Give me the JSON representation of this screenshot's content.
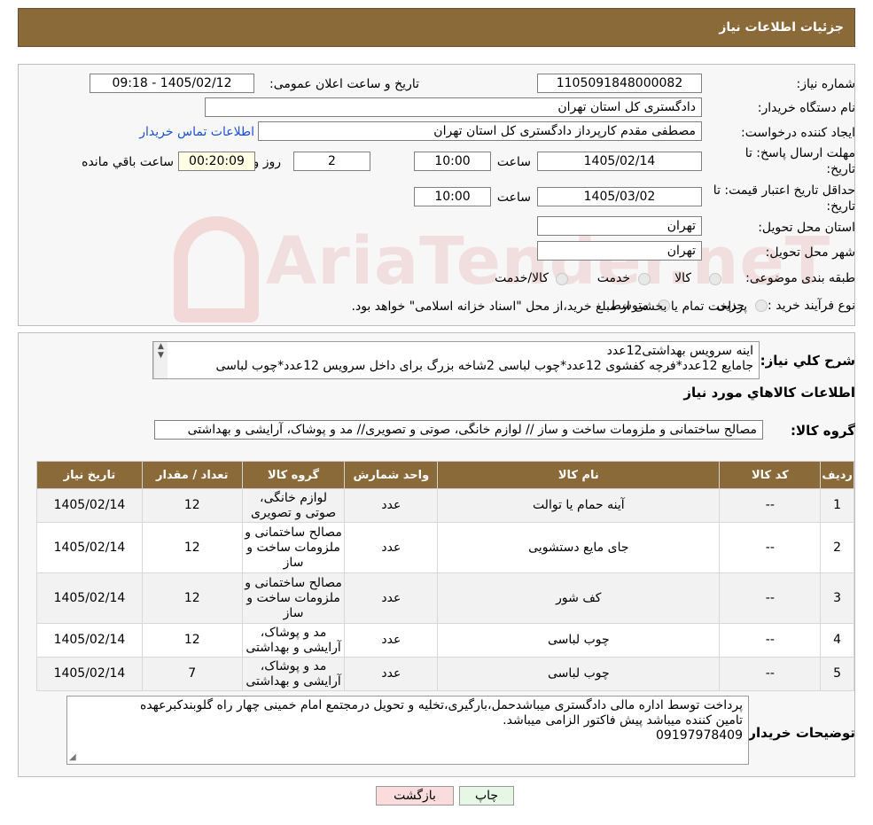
{
  "header": {
    "title": "جزئیات اطلاعات نیاز"
  },
  "fields": {
    "need_number_label": "شماره نیاز:",
    "need_number": "1105091848000082",
    "announce_label": "تاریخ و ساعت اعلان عمومی:",
    "announce_value": "1405/02/12 - 09:18",
    "buyer_org_label": "نام دستگاه خریدار:",
    "buyer_org": "دادگستری کل استان تهران",
    "creator_label": "ایجاد کننده درخواست:",
    "creator": "مصطفی مقدم کارپرداز دادگستری کل استان تهران",
    "contact_link": "اطلاعات تماس خریدار",
    "deadline_label_1": "مهلت ارسال پاسخ: تا",
    "deadline_label_2": "تاریخ:",
    "deadline_date": "1405/02/14",
    "time_label": "ساعت",
    "deadline_time": "10:00",
    "days_value": "2",
    "days_label": "روز و",
    "remaining_time": "00:20:09",
    "remaining_label": "ساعت باقي مانده",
    "validity_label_1": "حداقل تاریخ اعتبار قیمت: تا",
    "validity_label_2": "تاریخ:",
    "validity_date": "1405/03/02",
    "validity_time_label": "ساعت",
    "validity_time": "10:00",
    "province_label": "استان محل تحویل:",
    "province": "تهران",
    "city_label": "شهر محل تحویل:",
    "city": "تهران",
    "category_label": "طبقه بندی موضوعی:",
    "category_options": [
      "کالا",
      "خدمت",
      "کالا/خدمت"
    ],
    "process_label": "نوع فرآیند خرید :",
    "process_options": [
      "جزیی",
      "متوسط"
    ],
    "process_note": "پرداخت تمام یا بخشی از مبلغ خرید،از محل \"اسناد خزانه اسلامی\" خواهد بود."
  },
  "watermark": "AriaTender.neT",
  "description": {
    "label": "شرح کلي نياز:",
    "line1": "اینه سرویس بهداشتی12عدد",
    "line2": "جامایع 12عدد*فرچه کفشوی 12عدد*چوب لباسی 2شاخه بزرگ برای داخل سرویس 12عدد*چوب  لباسی"
  },
  "goods_info_title": "اطلاعات کالاهاي مورد نياز",
  "goods_group": {
    "label": "گروه کالا:",
    "value": "مصالح ساختمانی و ملزومات ساخت و ساز // لوازم خانگی، صوتی و تصویری// مد و پوشاک، آرایشی و بهداشتی"
  },
  "table": {
    "headers": [
      "ردیف",
      "کد کالا",
      "نام کالا",
      "واحد شمارش",
      "گروه کالا",
      "تعداد / مقدار",
      "تاریخ نیاز"
    ],
    "rows": [
      {
        "idx": "1",
        "code": "--",
        "name": "آینه حمام یا توالت",
        "unit": "عدد",
        "group": "لوازم خانگی، صوتی و تصویری",
        "qty": "12",
        "date": "1405/02/14"
      },
      {
        "idx": "2",
        "code": "--",
        "name": "جای مایع دستشویی",
        "unit": "عدد",
        "group": "مصالح ساختمانی و ملزومات ساخت و ساز",
        "qty": "12",
        "date": "1405/02/14"
      },
      {
        "idx": "3",
        "code": "--",
        "name": "کف شور",
        "unit": "عدد",
        "group": "مصالح ساختمانی و ملزومات ساخت و ساز",
        "qty": "12",
        "date": "1405/02/14"
      },
      {
        "idx": "4",
        "code": "--",
        "name": "چوب لباسی",
        "unit": "عدد",
        "group": "مد و پوشاک، آرایشی و بهداشتی",
        "qty": "12",
        "date": "1405/02/14"
      },
      {
        "idx": "5",
        "code": "--",
        "name": "چوب لباسی",
        "unit": "عدد",
        "group": "مد و پوشاک، آرایشی و بهداشتی",
        "qty": "7",
        "date": "1405/02/14"
      }
    ]
  },
  "buyer_notes": {
    "label": "توضیحات خریدار:",
    "line1": "پرداخت توسط اداره مالی دادگستری میباشدحمل،بارگیری،تخلیه و تحویل درمجتمع امام خمینی چهار راه گلوبندکبرعهده",
    "line2": "تامین کننده میباشد پیش فاکتور الزامی میباشد.",
    "line3": "09197978409"
  },
  "buttons": {
    "print": "چاپ",
    "back": "بازگشت"
  },
  "colors": {
    "header_bg": "#8b6a3a",
    "back_button_bg": "#fbdcdc",
    "print_button_bg": "#e6f7e6",
    "link": "#1a4fd8"
  }
}
